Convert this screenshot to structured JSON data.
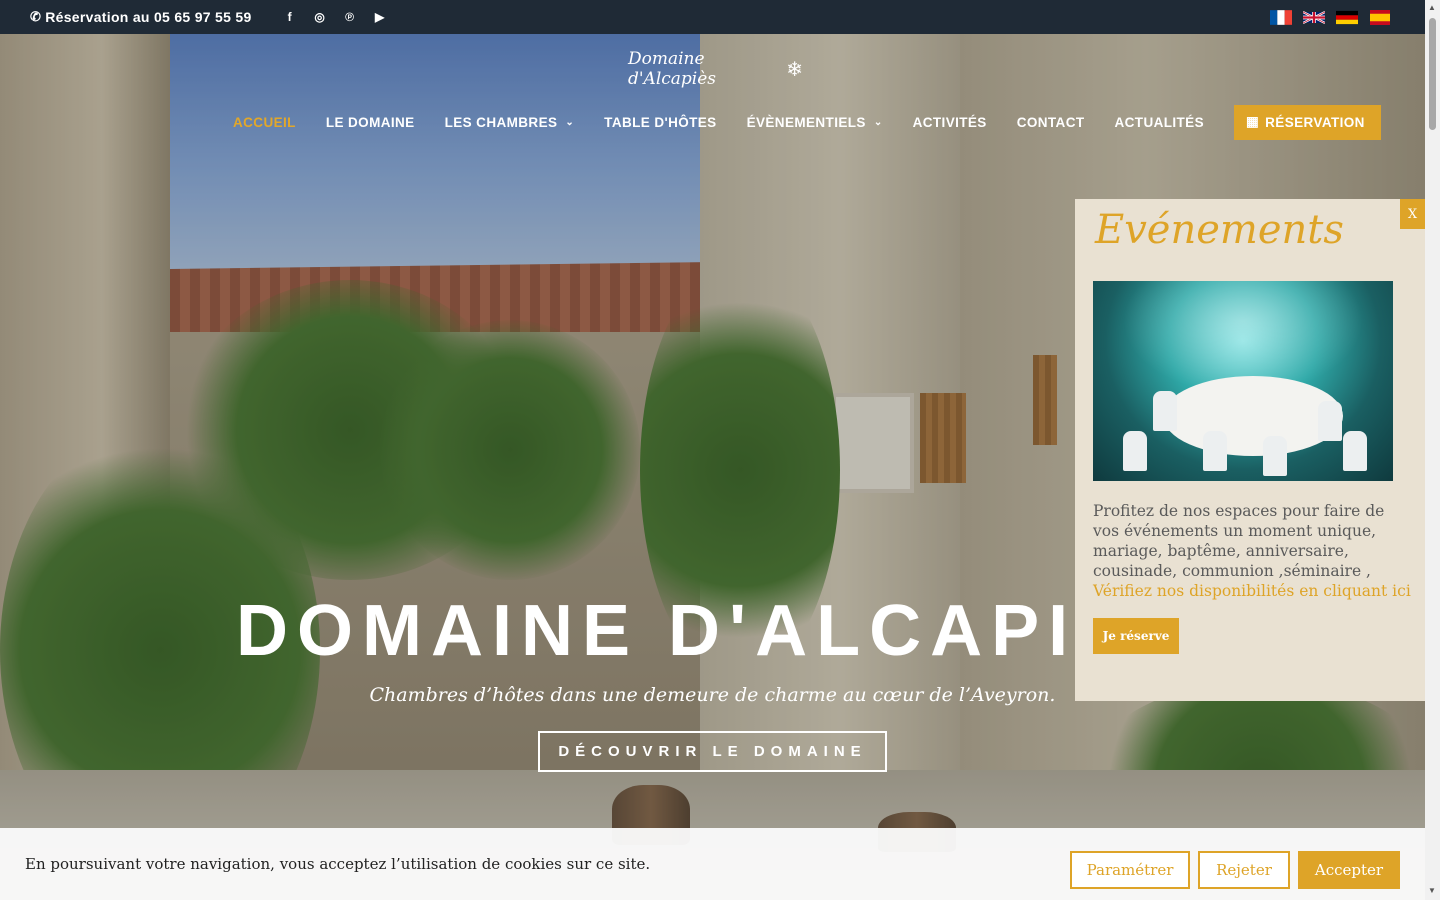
{
  "topbar": {
    "phone_text": "Réservation au 05 65 97 55 59",
    "phone_icon": "phone-icon",
    "socials": [
      {
        "name": "facebook-icon",
        "glyph": "f"
      },
      {
        "name": "instagram-icon",
        "glyph": "◎"
      },
      {
        "name": "pinterest-icon",
        "glyph": "℗"
      },
      {
        "name": "youtube-icon",
        "glyph": "▶"
      }
    ],
    "flags": [
      {
        "name": "flag-fr-icon",
        "lang": "fr"
      },
      {
        "name": "flag-en-icon",
        "lang": "en"
      },
      {
        "name": "flag-de-icon",
        "lang": "de"
      },
      {
        "name": "flag-es-icon",
        "lang": "es"
      }
    ]
  },
  "logo": {
    "text": "Domaine d'Alcapiès",
    "mark": "❄"
  },
  "nav": {
    "items": [
      {
        "label": "ACCUEIL",
        "active": true,
        "has_dropdown": false
      },
      {
        "label": "LE DOMAINE",
        "active": false,
        "has_dropdown": false
      },
      {
        "label": "LES CHAMBRES",
        "active": false,
        "has_dropdown": true
      },
      {
        "label": "TABLE D'HÔTES",
        "active": false,
        "has_dropdown": false
      },
      {
        "label": "ÉVÈNEMENTIELS",
        "active": false,
        "has_dropdown": true
      },
      {
        "label": "ACTIVITÉS",
        "active": false,
        "has_dropdown": false
      },
      {
        "label": "CONTACT",
        "active": false,
        "has_dropdown": false
      },
      {
        "label": "ACTUALITÉS",
        "active": false,
        "has_dropdown": false
      }
    ],
    "reservation_label": "RÉSERVATION",
    "reservation_icon": "calendar-icon",
    "accent_color": "#dea428"
  },
  "hero": {
    "title": "DOMAINE D'ALCAPI",
    "subtitle": "Chambres d’hôtes dans une demeure de charme au cœur de l’Aveyron.",
    "button_label": "DÉCOUVRIR LE DOMAINE"
  },
  "popup": {
    "close_label": "X",
    "title": "Evénements",
    "text": "Profitez de nos espaces pour faire de vos événements un moment unique, mariage, baptême, anniversaire, cousinade, communion ,séminaire ,",
    "link_text": "Vérifiez nos disponibilités en cliquant ici",
    "button_label": "Je réserve"
  },
  "cookie": {
    "text": "En poursuivant votre navigation, vous acceptez l’utilisation de cookies sur ce site.",
    "settings_label": "Paramétrer",
    "reject_label": "Rejeter",
    "accept_label": "Accepter"
  }
}
